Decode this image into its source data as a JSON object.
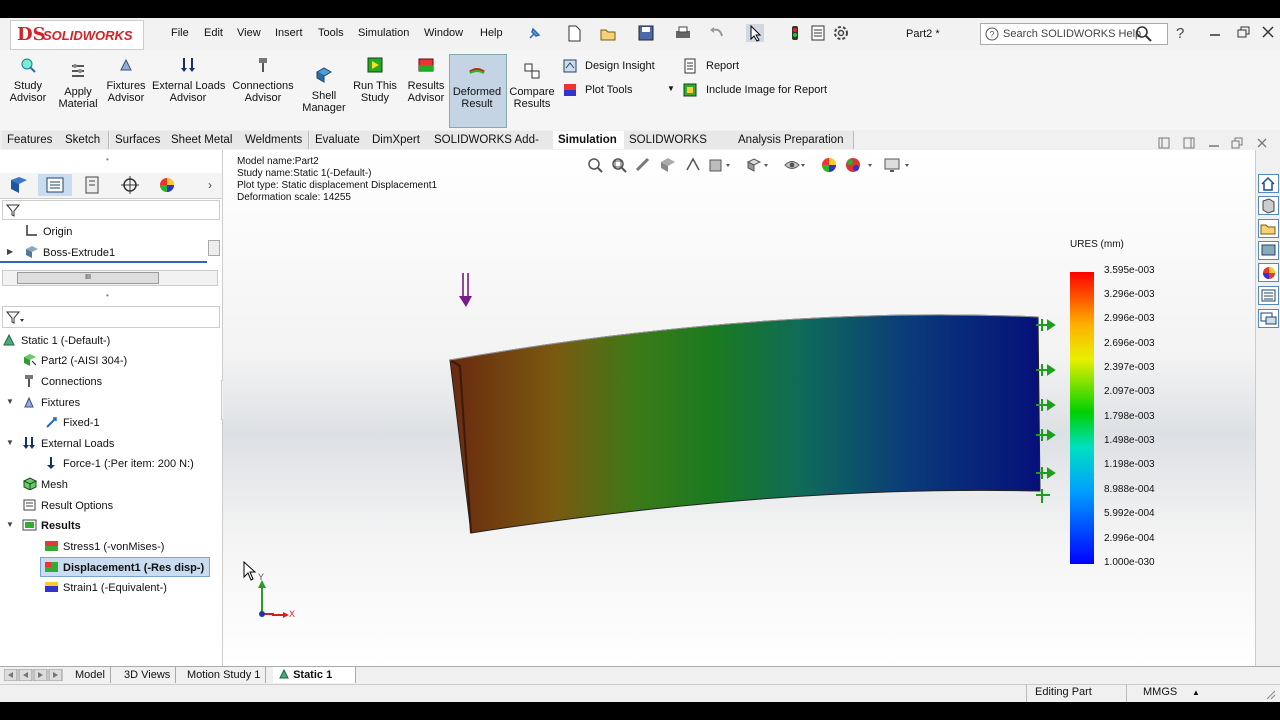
{
  "app": {
    "logo_mark": "DS",
    "logo_text": "SOLIDWORKS",
    "document_name": "Part2 *"
  },
  "menu": [
    "File",
    "Edit",
    "View",
    "Insert",
    "Tools",
    "Simulation",
    "Window",
    "Help"
  ],
  "search": {
    "placeholder": "Search SOLIDWORKS Help"
  },
  "help_label": "?",
  "commands": {
    "study_advisor": "Study\nAdvisor",
    "apply_material": "Apply\nMaterial",
    "fixtures_advisor": "Fixtures\nAdvisor",
    "external_loads_advisor": "External Loads\nAdvisor",
    "connections_advisor": "Connections\nAdvisor",
    "shell_manager": "Shell\nManager",
    "run_this_study": "Run This\nStudy",
    "results_advisor": "Results\nAdvisor",
    "deformed_result": "Deformed\nResult",
    "compare_results": "Compare\nResults",
    "design_insight": "Design Insight",
    "plot_tools": "Plot Tools",
    "report": "Report",
    "include_image": "Include Image for Report"
  },
  "tabs": [
    "Features",
    "Sketch",
    "Surfaces",
    "Sheet Metal",
    "Weldments",
    "Evaluate",
    "DimXpert",
    "SOLIDWORKS Add-Ins",
    "Simulation",
    "SOLIDWORKS MBD",
    "Analysis Preparation"
  ],
  "active_tab": "Simulation",
  "feature_tree": {
    "items": [
      "Origin",
      "Boss-Extrude1"
    ],
    "scroll_label": "III"
  },
  "study_tree": {
    "root": "Static 1 (-Default-)",
    "part": "Part2 (-AISI 304-)",
    "connections": "Connections",
    "fixtures": "Fixtures",
    "fixed": "Fixed-1",
    "external_loads": "External Loads",
    "force": "Force-1 (:Per item: 200 N:)",
    "mesh": "Mesh",
    "result_options": "Result Options",
    "results": "Results",
    "stress": "Stress1 (-vonMises-)",
    "displacement": "Displacement1 (-Res disp-)",
    "strain": "Strain1 (-Equivalent-)"
  },
  "plot_info": {
    "model_name": "Model name:Part2",
    "study_name": "Study name:Static 1(-Default-)",
    "plot_type": "Plot type: Static displacement Displacement1",
    "deformation_scale": "Deformation scale: 14255"
  },
  "legend": {
    "title": "URES (mm)",
    "values": [
      "3.595e-003",
      "3.296e-003",
      "2.996e-003",
      "2.696e-003",
      "2.397e-003",
      "2.097e-003",
      "1.798e-003",
      "1.498e-003",
      "1.198e-003",
      "8.988e-004",
      "5.992e-004",
      "2.996e-004",
      "1.000e-030"
    ]
  },
  "triad": {
    "x": "X",
    "y": "Y"
  },
  "bottom_tabs": [
    "Model",
    "3D Views",
    "Motion Study 1",
    "Static 1"
  ],
  "active_bottom_tab": "Static 1",
  "status": {
    "mode": "Editing Part",
    "units": "MMGS"
  },
  "colors": {
    "sw_red": "#d2232a",
    "load_arrow": "#7a1a8a",
    "fixture_green": "#1e9e1e",
    "selection": "#c9dcf0"
  }
}
